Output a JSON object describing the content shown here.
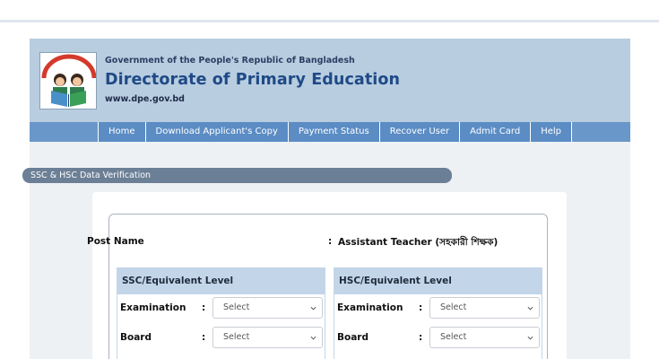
{
  "header": {
    "government": "Government of the People's Republic of Bangladesh",
    "title": "Directorate of Primary Education",
    "url": "www.dpe.gov.bd"
  },
  "nav": {
    "items": [
      "Home",
      "Download Applicant's Copy",
      "Payment Status",
      "Recover User",
      "Admit Card",
      "Help"
    ]
  },
  "form": {
    "legend": "SSC & HSC Data Verification",
    "post_name_label": "Post Name",
    "post_colon": ":",
    "post_name_value": "Assistant Teacher (সহকারী শিক্ষক)",
    "ssc": {
      "heading": "SSC/Equivalent Level",
      "examination_label": "Examination",
      "examination_value": "Select",
      "board_label": "Board",
      "board_value": "Select",
      "colon": ":"
    },
    "hsc": {
      "heading": "HSC/Equivalent Level",
      "examination_label": "Examination",
      "examination_value": "Select",
      "board_label": "Board",
      "board_value": "Select",
      "colon": ":"
    }
  },
  "colors": {
    "header_bg": "#b8cde0",
    "nav_bg": "#5b8cc4",
    "title": "#1f4a86",
    "legend_bg": "#6b7f96",
    "panel_head": "#c3d6e9"
  },
  "icons": [
    "dpe-logo",
    "chevron-down-icon"
  ]
}
